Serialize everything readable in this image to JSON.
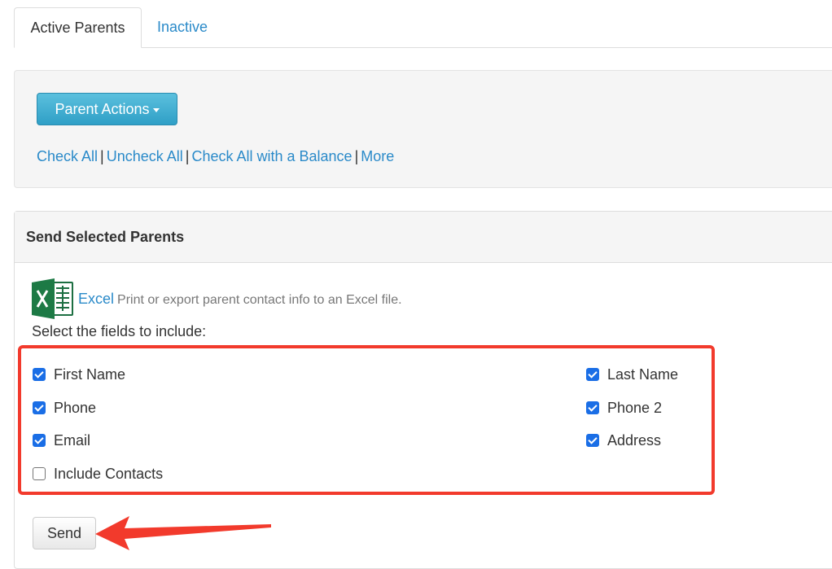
{
  "tabs": [
    {
      "label": "Active Parents",
      "active": true
    },
    {
      "label": "Inactive",
      "active": false
    }
  ],
  "actions": {
    "button_label": "Parent Actions",
    "links": [
      "Check All",
      "Uncheck All",
      "Check All with a Balance",
      "More"
    ],
    "separator": "|"
  },
  "send_panel": {
    "title": "Send Selected Parents",
    "excel_link": "Excel",
    "excel_description": "Print or export parent contact info to an Excel file.",
    "fields_label": "Select the fields to include:",
    "fields": [
      {
        "label": "First Name",
        "checked": true
      },
      {
        "label": "Last Name",
        "checked": true
      },
      {
        "label": "Phone",
        "checked": true
      },
      {
        "label": "Phone 2",
        "checked": true
      },
      {
        "label": "Email",
        "checked": true
      },
      {
        "label": "Address",
        "checked": true
      },
      {
        "label": "Include Contacts",
        "checked": false
      }
    ],
    "send_label": "Send"
  },
  "colors": {
    "link": "#2a8ac9",
    "primary_button": "#3aa9d0",
    "highlight_border": "#f23a2c",
    "checkbox": "#1a6ee6"
  },
  "icons": {
    "excel": "excel-icon",
    "caret": "caret-down-icon",
    "annotation": "red-arrow-icon"
  }
}
